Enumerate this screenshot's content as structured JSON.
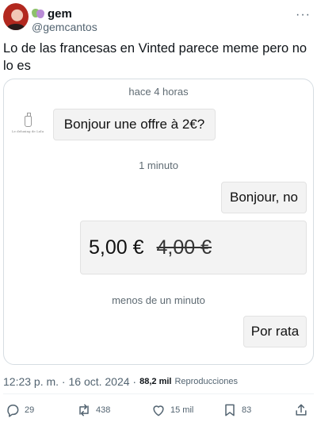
{
  "author": {
    "display_name": "gem",
    "handle": "@gemcantos",
    "badge_icon": "theater-masks-emoji-icon"
  },
  "tweet": {
    "text": "Lo de las francesas en Vinted parece meme pero no lo es"
  },
  "screenshot": {
    "sep1": "hace 4 horas",
    "msg_in": "Bonjour une offre à 2€?",
    "shop_caption": "Le deluxing de Lulu",
    "sep2": "1 minuto",
    "msg_out1": "Bonjour, no",
    "offer_price": "5,00 €",
    "original_price": "4,00 €",
    "sep3": "menos de un minuto",
    "msg_out2": "Por rata"
  },
  "meta": {
    "timestamp": "12:23 p. m. · 16 oct. 2024 ·",
    "views_count": "88,2 mil",
    "views_label": "Reproducciones"
  },
  "actions": {
    "replies": "29",
    "retweets": "438",
    "likes": "15 mil",
    "bookmarks": "83"
  },
  "colors": {
    "text": "#0f1419",
    "secondary": "#536471",
    "bubble": "#f3f3f3"
  }
}
